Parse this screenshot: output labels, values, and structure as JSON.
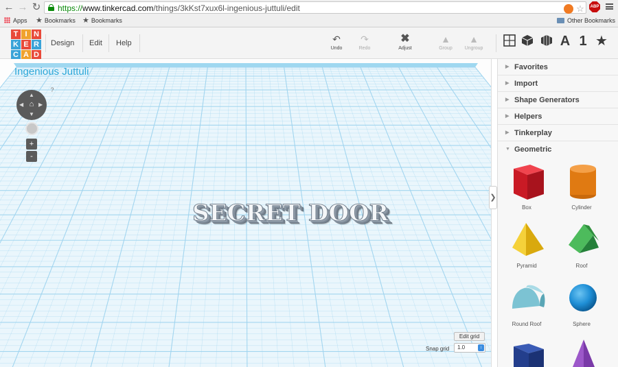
{
  "browser": {
    "url_scheme": "https://",
    "url_host": "www.tinkercad.com",
    "url_path": "/things/3kKst7xux6l-ingenious-juttuli/edit",
    "bookmarks": [
      "Apps",
      "Bookmarks",
      "Bookmarks"
    ],
    "other_bookmarks": "Other Bookmarks",
    "abp_label": "ABP"
  },
  "header": {
    "logo_letters": [
      "T",
      "I",
      "N",
      "K",
      "E",
      "R",
      "C",
      "A",
      "D"
    ],
    "menu": [
      "Design",
      "Edit",
      "Help"
    ],
    "tools": [
      {
        "label": "Undo",
        "icon": "undo-icon",
        "enabled": true
      },
      {
        "label": "Redo",
        "icon": "redo-icon",
        "enabled": false
      },
      {
        "label": "Adjust",
        "icon": "adjust-icon",
        "enabled": true
      },
      {
        "label": "Group",
        "icon": "group-icon",
        "enabled": false
      },
      {
        "label": "Ungroup",
        "icon": "ungroup-icon",
        "enabled": false
      }
    ],
    "view_icons": [
      "grid-view-icon",
      "box-view-icon",
      "wireframe-view-icon",
      "text-icon",
      "number-icon",
      "star-icon"
    ],
    "view_text_a": "A",
    "view_text_1": "1",
    "view_star": "★"
  },
  "workplane": {
    "design_title": "Ingenious Juttuli",
    "help_mark": "?",
    "zoom_in": "+",
    "zoom_out": "-",
    "object_text": "SECRET DOOR",
    "edit_grid": "Edit grid",
    "snap_grid_label": "Snap grid",
    "snap_grid_value": "1.0",
    "grid_color": "#9fd4ef",
    "accent": "#2ba7d8"
  },
  "panel": {
    "categories": [
      {
        "label": "Favorites",
        "expanded": false
      },
      {
        "label": "Import",
        "expanded": false
      },
      {
        "label": "Shape Generators",
        "expanded": false
      },
      {
        "label": "Helpers",
        "expanded": false
      },
      {
        "label": "Tinkerplay",
        "expanded": false
      },
      {
        "label": "Geometric",
        "expanded": true
      }
    ],
    "shapes": [
      {
        "label": "Box",
        "color": "#d61f2b"
      },
      {
        "label": "Cylinder",
        "color": "#e8871e"
      },
      {
        "label": "Pyramid",
        "color": "#f2c51d"
      },
      {
        "label": "Roof",
        "color": "#3aa64a"
      },
      {
        "label": "Round Roof",
        "color": "#7cc3d3"
      },
      {
        "label": "Sphere",
        "color": "#1f8fd6"
      }
    ]
  }
}
